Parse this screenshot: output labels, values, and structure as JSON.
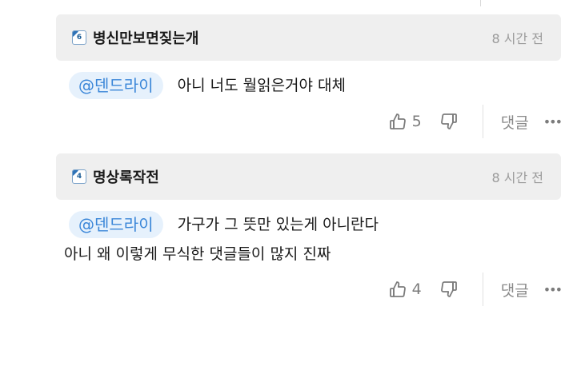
{
  "comments": [
    {
      "level": "6",
      "author": "병신만보면짖는개",
      "time": "8 시간 전",
      "mention": "@덴드라이",
      "lines": [
        "아니 너도 뭘읽은거야 대체"
      ],
      "likes": "5",
      "reply_label": "댓글",
      "more_label": "•••"
    },
    {
      "level": "4",
      "author": "명상록작전",
      "time": "8 시간 전",
      "mention": "@덴드라이",
      "lines": [
        "가구가 그 뜻만 있는게 아니란다",
        "아니 왜 이렇게 무식한 댓글들이 많지 진짜"
      ],
      "likes": "4",
      "reply_label": "댓글",
      "more_label": "•••"
    }
  ],
  "icons": {
    "like": "thumbs-up-icon",
    "dislike": "thumbs-down-icon",
    "more": "more-options-icon"
  },
  "colors": {
    "mention_text": "#3a86d8",
    "mention_bg": "#e6f1fc",
    "header_bg": "#efefef",
    "level_badge": "#2f73b7"
  }
}
